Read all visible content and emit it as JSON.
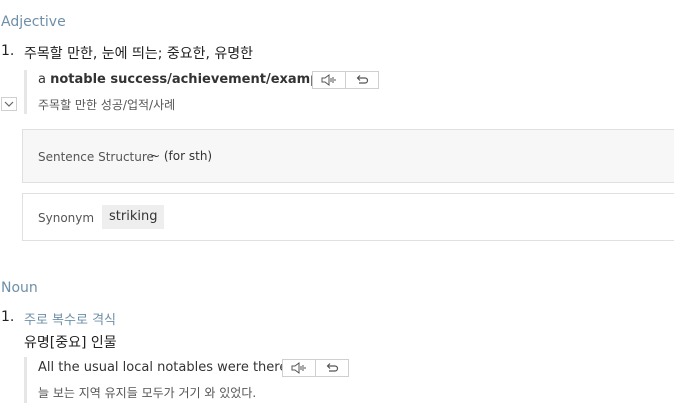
{
  "adjective": {
    "pos_label": "Adjective",
    "number": "1.",
    "definition": "주목할 만한, 눈에 띄는; 중요한, 유명한",
    "example": {
      "prefix": "a",
      "bold": "notable success/achievement/example",
      "translation": "주목할 만한 성공/업적/사례"
    },
    "sentence_structure": {
      "label": "Sentence Structure",
      "value": "~ (for sth)"
    },
    "synonym": {
      "label": "Synonym",
      "value": "striking"
    }
  },
  "noun": {
    "pos_label": "Noun",
    "number": "1.",
    "usage_note": "주로 복수로 격식",
    "definition": "유명[중요] 인물",
    "example": {
      "text": "All the usual local notables were there.",
      "translation": "늘 보는 지역 유지들 모두가 거기 와 있었다."
    }
  },
  "icons": {
    "speaker": "speaker-icon",
    "repeat": "repeat-icon",
    "toggle": "chevron-down-icon"
  },
  "colors": {
    "pos": "#6e8fa8",
    "panel_bg": "#f7f7f7",
    "border": "#e0e0e0"
  }
}
